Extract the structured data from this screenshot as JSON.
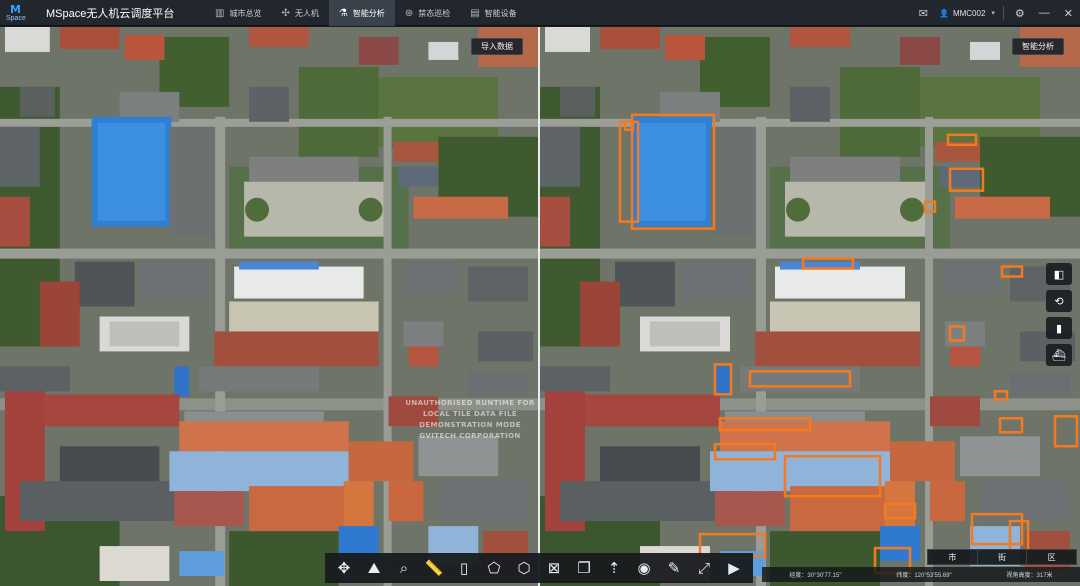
{
  "app": {
    "logo_text": "M",
    "logo_sub": "Space",
    "title": "MSpace无人机云调度平台"
  },
  "nav": [
    {
      "label": "城市总览",
      "icon": "building-icon",
      "glyph": "▥"
    },
    {
      "label": "无人机",
      "icon": "drone-icon",
      "glyph": "✣"
    },
    {
      "label": "智能分析",
      "icon": "analysis-icon",
      "glyph": "⚗"
    },
    {
      "label": "禁态巡检",
      "icon": "patrol-icon",
      "glyph": "⊛"
    },
    {
      "label": "智能设备",
      "icon": "device-icon",
      "glyph": "▤"
    }
  ],
  "header_right": {
    "message_glyph": "✉",
    "user_glyph": "👤",
    "username": "MMC002",
    "caret": "▾",
    "settings_glyph": "⚙",
    "minimize_glyph": "—",
    "close_glyph": "✕"
  },
  "left_panel": {
    "button_label": "导入数据"
  },
  "right_panel": {
    "button_label": "智能分析"
  },
  "watermark": {
    "line1": "UNAUTHORISED RUNTIME FOR LOCAL TILE DATA FILE",
    "line2": "DEMONSTRATION MODE",
    "line3": "GVITECH CORPORATION"
  },
  "side_tools": [
    {
      "name": "layout-icon",
      "glyph": "◧"
    },
    {
      "name": "compare-search-icon",
      "glyph": "⟲"
    },
    {
      "name": "building-marker-icon",
      "glyph": "▮"
    },
    {
      "name": "ship-icon",
      "glyph": "⛴"
    }
  ],
  "toolbar": [
    {
      "name": "move-icon",
      "glyph": "✥"
    },
    {
      "name": "layers-terrain-icon",
      "glyph": "⛰"
    },
    {
      "name": "search-icon",
      "glyph": "⌕"
    },
    {
      "name": "ruler-icon",
      "glyph": "📏"
    },
    {
      "name": "vertical-ruler-icon",
      "glyph": "▯"
    },
    {
      "name": "area-measure-icon",
      "glyph": "⬠"
    },
    {
      "name": "cube-icon",
      "glyph": "⬡"
    },
    {
      "name": "box-crop-icon",
      "glyph": "⊠"
    },
    {
      "name": "document-icon",
      "glyph": "❐"
    },
    {
      "name": "north-arrow-icon",
      "glyph": "⇡"
    },
    {
      "name": "eye-icon",
      "glyph": "◉"
    },
    {
      "name": "pen-icon",
      "glyph": "✎"
    },
    {
      "name": "fullscreen-icon",
      "glyph": "⤢"
    },
    {
      "name": "video-icon",
      "glyph": "▶"
    }
  ],
  "region_tabs": [
    "市",
    "街",
    "区"
  ],
  "status": {
    "longitude": "经度：30°30'77.15\"",
    "latitude": "纬度：120°53'55.69\"",
    "height": "视角高度：317米"
  },
  "colors": {
    "accent": "#3a424c",
    "detect_outline": "#f47a20",
    "roof_blue": "#3c8fe0"
  }
}
